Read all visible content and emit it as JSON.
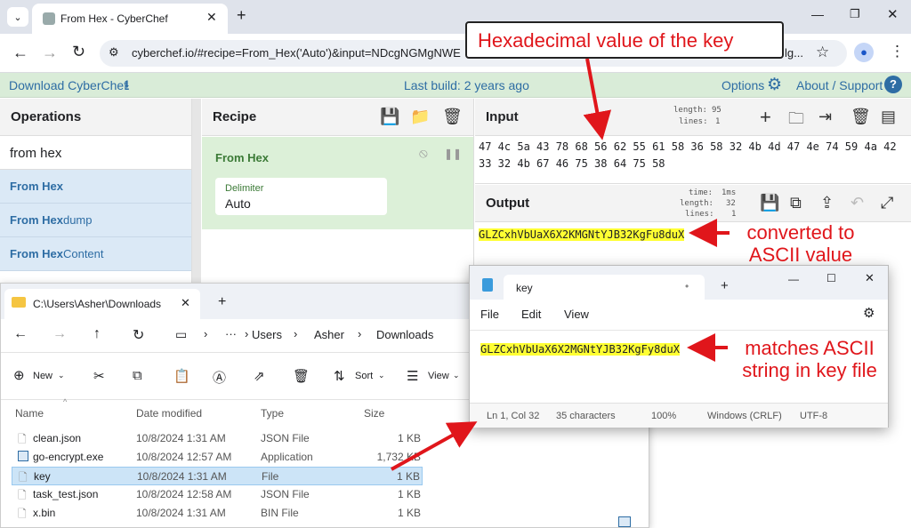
{
  "browser": {
    "tab_title": "From Hex - CyberChef",
    "url": "cyberchef.io/#recipe=From_Hex('Auto')&input=NDcgNGMgNWE",
    "url_tail": "lg..."
  },
  "banner": {
    "download": "Download CyberChef",
    "build": "Last build: 2 years ago",
    "options": "Options",
    "about": "About / Support"
  },
  "operations": {
    "title": "Operations",
    "search_value": "from hex",
    "items": [
      {
        "match": "From Hex",
        "rest": ""
      },
      {
        "match": "From Hex",
        "rest": "dump"
      },
      {
        "match": "From Hex",
        "rest": " Content"
      }
    ]
  },
  "recipe": {
    "title": "Recipe",
    "op_title": "From Hex",
    "delimiter_label": "Delimiter",
    "delimiter_value": "Auto"
  },
  "input": {
    "title": "Input",
    "length_label": "length:",
    "length": "95",
    "lines_label": "lines:",
    "lines": "1",
    "hex_line1": "47 4c 5a 43 78 68 56 62 55 61 58 36 58 32 4b 4d 47 4e 74 59 4a 42",
    "hex_line2": "33 32 4b 67 46 75 38 64 75 58"
  },
  "output": {
    "title": "Output",
    "time_label": "time:",
    "time": "1ms",
    "length_label": "length:",
    "length": "32",
    "lines_label": "lines:",
    "lines": "1",
    "value": "GLZCxhVbUaX6X2KMGNtYJB32KgFu8duX"
  },
  "annotations": {
    "hex": "Hexadecimal value of the key",
    "converted": "converted to\nASCII value",
    "matches": "matches ASCII\nstring in key file"
  },
  "explorer": {
    "tab_title": "C:\\Users\\Asher\\Downloads",
    "crumbs": [
      "Users",
      "Asher",
      "Downloads"
    ],
    "ellipsis": "···",
    "toolbar": {
      "new": "New",
      "sort": "Sort",
      "view": "View"
    },
    "columns": {
      "name": "Name",
      "date": "Date modified",
      "type": "Type",
      "size": "Size"
    },
    "files": [
      {
        "name": "clean.json",
        "date": "10/8/2024 1:31 AM",
        "type": "JSON File",
        "size": "1 KB"
      },
      {
        "name": "go-encrypt.exe",
        "date": "10/8/2024 12:57 AM",
        "type": "Application",
        "size": "1,732 KB"
      },
      {
        "name": "key",
        "date": "10/8/2024 1:31 AM",
        "type": "File",
        "size": "1 KB"
      },
      {
        "name": "task_test.json",
        "date": "10/8/2024 12:58 AM",
        "type": "JSON File",
        "size": "1 KB"
      },
      {
        "name": "x.bin",
        "date": "10/8/2024 1:31 AM",
        "type": "BIN File",
        "size": "1 KB"
      }
    ]
  },
  "notepad": {
    "tab_title": "key",
    "menu": {
      "file": "File",
      "edit": "Edit",
      "view": "View"
    },
    "content": "GLZCxhVbUaX6X2MGNtYJB32KgFy8duX",
    "status": {
      "position": "Ln 1, Col 32",
      "chars": "35 characters",
      "zoom": "100%",
      "eol": "Windows (CRLF)",
      "encoding": "UTF-8"
    }
  },
  "colors": {
    "accent_green": "#d9ecd8",
    "recipe_green": "#dcf0d8",
    "op_blue": "#dbe9f6",
    "highlight": "#ffff33",
    "annotation_red": "#e0161b"
  }
}
